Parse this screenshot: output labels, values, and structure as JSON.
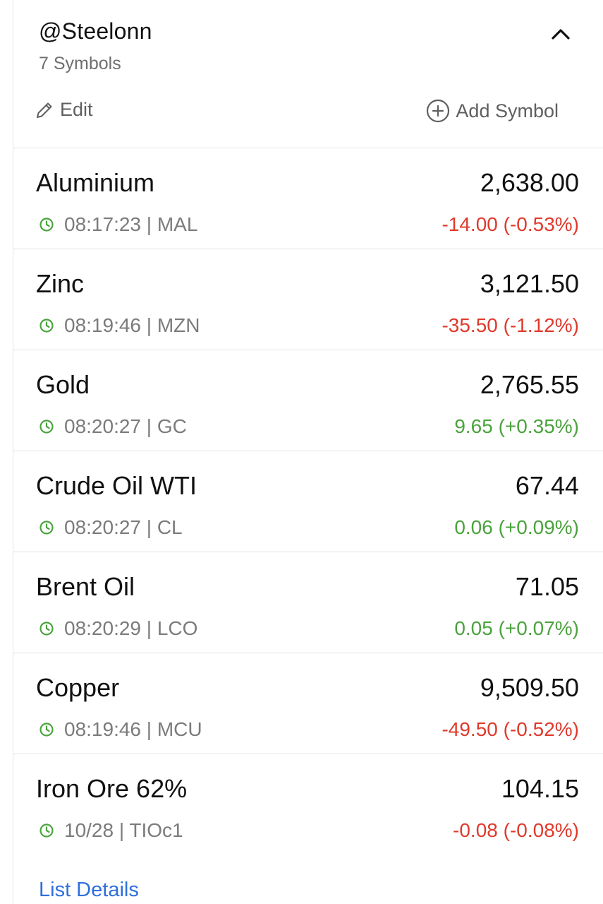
{
  "watchlist": {
    "title": "@Steelonn",
    "count": "7 Symbols",
    "edit_label": "Edit",
    "add_label": "Add Symbol",
    "collapse_icon": "chevron-up-icon",
    "details_label": "List Details"
  },
  "colors": {
    "negative": "#e0392b",
    "positive": "#4aa33c",
    "clock": "#4aa33c",
    "link": "#2f6fdc"
  },
  "symbols": [
    {
      "name": "Aluminium",
      "price": "2,638.00",
      "time": "08:17:23",
      "code": "MAL",
      "meta": "08:17:23 | MAL",
      "change": "-14.00 (-0.53%)",
      "direction": "neg"
    },
    {
      "name": "Zinc",
      "price": "3,121.50",
      "time": "08:19:46",
      "code": "MZN",
      "meta": "08:19:46 | MZN",
      "change": "-35.50 (-1.12%)",
      "direction": "neg"
    },
    {
      "name": "Gold",
      "price": "2,765.55",
      "time": "08:20:27",
      "code": "GC",
      "meta": "08:20:27 | GC",
      "change": "9.65 (+0.35%)",
      "direction": "pos"
    },
    {
      "name": "Crude Oil WTI",
      "price": "67.44",
      "time": "08:20:27",
      "code": "CL",
      "meta": "08:20:27 | CL",
      "change": "0.06 (+0.09%)",
      "direction": "pos"
    },
    {
      "name": "Brent Oil",
      "price": "71.05",
      "time": "08:20:29",
      "code": "LCO",
      "meta": "08:20:29 | LCO",
      "change": "0.05 (+0.07%)",
      "direction": "pos"
    },
    {
      "name": "Copper",
      "price": "9,509.50",
      "time": "08:19:46",
      "code": "MCU",
      "meta": "08:19:46 | MCU",
      "change": "-49.50 (-0.52%)",
      "direction": "neg"
    },
    {
      "name": "Iron Ore 62%",
      "price": "104.15",
      "time": "10/28",
      "code": "TIOc1",
      "meta": "10/28 | TIOc1",
      "change": "-0.08 (-0.08%)",
      "direction": "neg"
    }
  ]
}
